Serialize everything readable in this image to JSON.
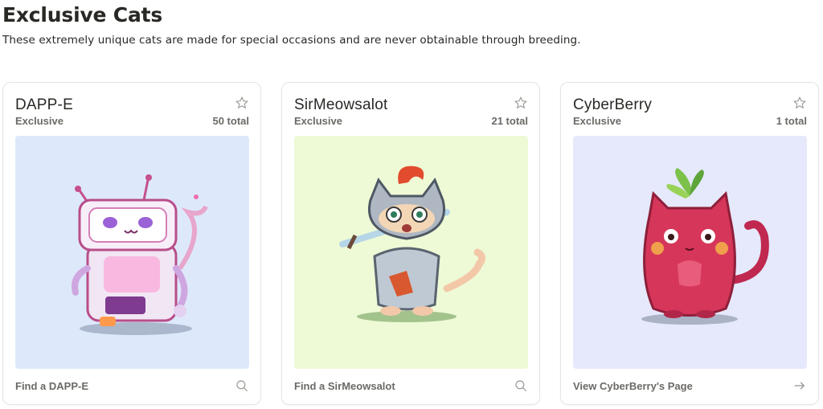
{
  "header": {
    "title": "Exclusive Cats",
    "subtitle": "These extremely unique cats are made for special occasions and are never obtainable through breeding."
  },
  "cards": [
    {
      "name": "DAPP-E",
      "category": "Exclusive",
      "total": "50 total",
      "footer_link": "Find a DAPP-E",
      "footer_icon": "search-icon",
      "background": "#dde9fb"
    },
    {
      "name": "SirMeowsalot",
      "category": "Exclusive",
      "total": "21 total",
      "footer_link": "Find a SirMeowsalot",
      "footer_icon": "search-icon",
      "background": "#eefad6"
    },
    {
      "name": "CyberBerry",
      "category": "Exclusive",
      "total": "1 total",
      "footer_link": "View CyberBerry's Page",
      "footer_icon": "arrow-right-icon",
      "background": "#e5e9fb"
    }
  ],
  "icons": {
    "favorite": "star-outline-icon"
  },
  "colors": {
    "text": "#2a2825",
    "muted": "#6c6a66",
    "border": "#e7e5e2"
  }
}
